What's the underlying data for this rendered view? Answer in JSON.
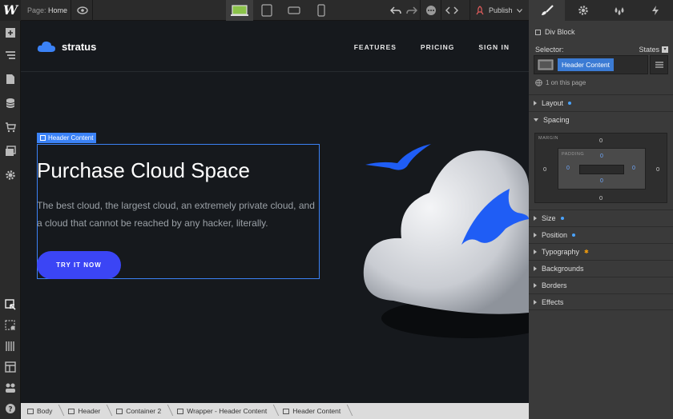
{
  "topbar": {
    "logo": "W",
    "page_prefix": "Page:",
    "page_name": "Home",
    "publish_label": "Publish"
  },
  "site": {
    "brand": "stratus",
    "nav": [
      "FEATURES",
      "PRICING",
      "SIGN IN"
    ],
    "selected_tag": "Header Content",
    "hero_title": "Purchase Cloud Space",
    "hero_text": "The best cloud, the largest cloud, an extremely private cloud, and a cloud that cannot be reached by any hacker, literally.",
    "cta": "TRY IT NOW"
  },
  "breadcrumbs": [
    "Body",
    "Header",
    "Container 2",
    "Wrapper - Header Content",
    "Header Content"
  ],
  "panel": {
    "element_type": "Div Block",
    "selector_label": "Selector:",
    "states_label": "States",
    "selector_chip": "Header Content",
    "on_page": "1 on this page",
    "sections": {
      "layout": "Layout",
      "spacing": "Spacing",
      "size": "Size",
      "position": "Position",
      "typography": "Typography",
      "backgrounds": "Backgrounds",
      "borders": "Borders",
      "effects": "Effects"
    },
    "box_model": {
      "margin_label": "MARGIN",
      "padding_label": "PADDING",
      "margin_top": "0",
      "margin_right": "0",
      "margin_bottom": "0",
      "margin_left": "0",
      "padding_top": "0",
      "padding_right": "0",
      "padding_bottom": "0",
      "padding_left": "0"
    }
  },
  "colors": {
    "accent": "#3b82f6",
    "cta": "#3b45f5",
    "bird": "#1f5df5"
  }
}
